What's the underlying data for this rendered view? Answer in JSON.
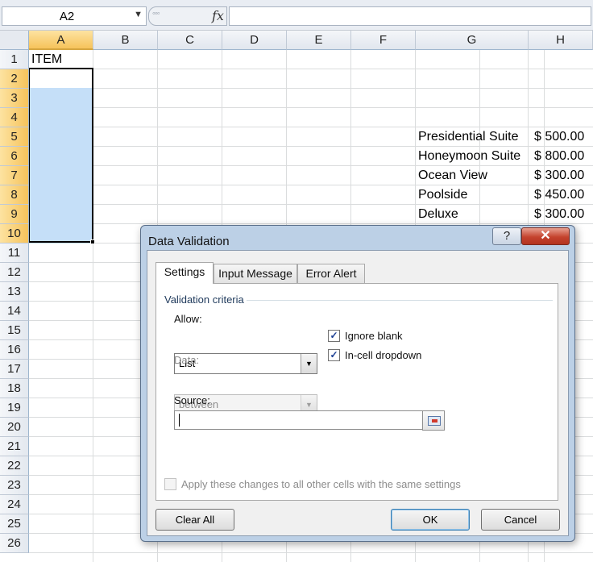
{
  "formula_bar": {
    "name_box": "A2",
    "dropdown_arrow": "▼",
    "grip": "◦◦◦",
    "fx_label": "fx",
    "formula": ""
  },
  "grid": {
    "columns": [
      "A",
      "B",
      "C",
      "D",
      "E",
      "F",
      "G",
      "H"
    ],
    "selected_column": "A",
    "rows": [
      "1",
      "2",
      "3",
      "4",
      "5",
      "6",
      "7",
      "8",
      "9",
      "10",
      "11",
      "12",
      "13",
      "14",
      "15",
      "16",
      "17",
      "18",
      "19",
      "20",
      "21",
      "22",
      "23",
      "24",
      "25",
      "26"
    ],
    "selected_rows": [
      "2",
      "3",
      "4",
      "5",
      "6",
      "7",
      "8",
      "9",
      "10"
    ],
    "cells": {
      "A1": "ITEM",
      "G5": "Presidential Suite",
      "H5": "$ 500.00",
      "G6": "Honeymoon Suite",
      "H6": "$ 800.00",
      "G7": "Ocean View",
      "H7": "$ 300.00",
      "G8": "Poolside",
      "H8": "$ 450.00",
      "G9": "Deluxe",
      "H9": "$ 300.00"
    },
    "selection_color": "#c5dff8"
  },
  "dialog": {
    "title": "Data Validation",
    "help_label": "?",
    "close_label": "✕",
    "tabs": [
      "Settings",
      "Input Message",
      "Error Alert"
    ],
    "active_tab": "Settings",
    "group_label": "Validation criteria",
    "allow_label": "Allow:",
    "allow_value": "List",
    "data_label": "Data:",
    "data_value": "between",
    "ignore_blank_label": "Ignore blank",
    "ignore_blank_checked": true,
    "in_cell_dropdown_label": "In-cell dropdown",
    "in_cell_dropdown_checked": true,
    "source_label": "Source:",
    "source_value": "",
    "apply_all_label": "Apply these changes to all other cells with the same settings",
    "apply_all_checked": false,
    "check_mark": "✓",
    "combo_arrow": "▼",
    "buttons": {
      "clear_all": "Clear All",
      "ok": "OK",
      "cancel": "Cancel"
    }
  }
}
